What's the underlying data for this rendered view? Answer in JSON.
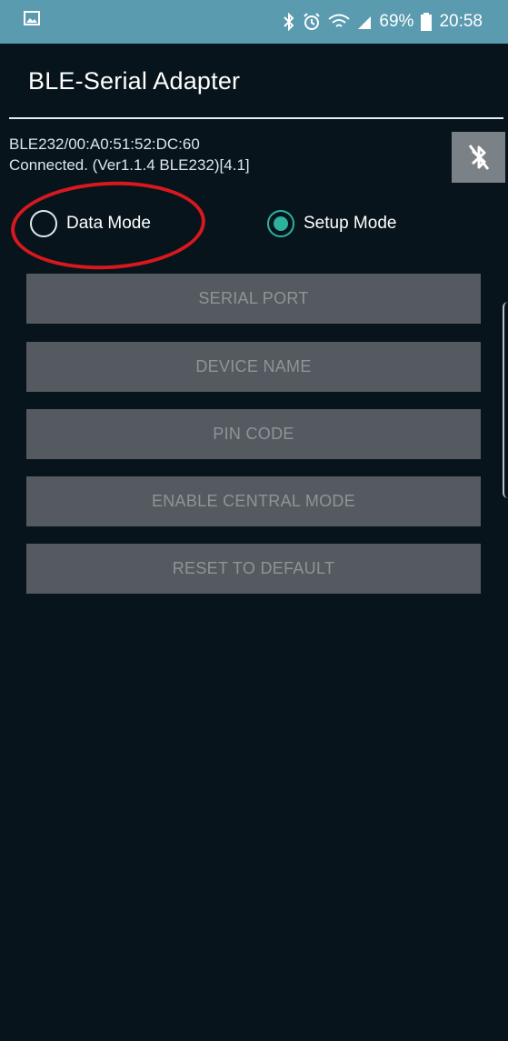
{
  "status_bar": {
    "battery": "69%",
    "time": "20:58"
  },
  "app": {
    "title": "BLE-Serial Adapter"
  },
  "device": {
    "address": "BLE232/00:A0:51:52:DC:60",
    "status": "Connected. (Ver1.1.4 BLE232)[4.1]"
  },
  "modes": {
    "data_label": "Data Mode",
    "setup_label": "Setup Mode",
    "selected": "Setup Mode"
  },
  "buttons": {
    "serial_port": "SERIAL PORT",
    "device_name": "DEVICE NAME",
    "pin_code": "PIN CODE",
    "enable_central_mode": "ENABLE CENTRAL MODE",
    "reset_to_default": "RESET TO DEFAULT"
  },
  "colors": {
    "status_bar": "#5a9bb0",
    "background": "#07141c",
    "accent": "#2bb3a0",
    "button_bg": "#545a5f",
    "annotation": "#d8181e"
  }
}
